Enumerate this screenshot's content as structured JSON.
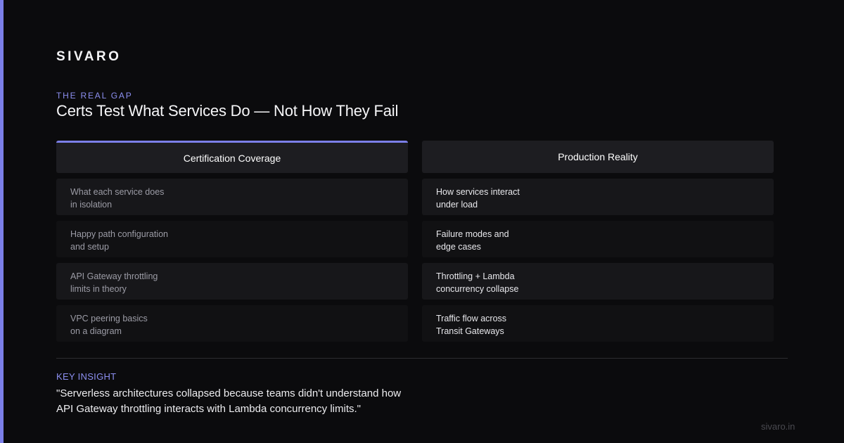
{
  "brand": "SIVARO",
  "eyebrow": "THE REAL GAP",
  "headline": "Certs Test What Services Do — Not How They Fail",
  "left_column": {
    "header": "Certification Coverage",
    "rows": [
      {
        "line1": "What each service does",
        "line2": "in isolation"
      },
      {
        "line1": "Happy path configuration",
        "line2": "and setup"
      },
      {
        "line1": "API Gateway throttling",
        "line2": "limits in theory"
      },
      {
        "line1": "VPC peering basics",
        "line2": "on a diagram"
      }
    ]
  },
  "right_column": {
    "header": "Production Reality",
    "rows": [
      {
        "line1": "How services interact",
        "line2": "under load"
      },
      {
        "line1": "Failure modes and",
        "line2": "edge cases"
      },
      {
        "line1": "Throttling + Lambda",
        "line2": "concurrency collapse"
      },
      {
        "line1": "Traffic flow across",
        "line2": "Transit Gateways"
      }
    ]
  },
  "insight": {
    "label": "KEY INSIGHT",
    "line1": "\"Serverless architectures collapsed because teams didn't understand how",
    "line2": "API Gateway throttling interacts with Lambda concurrency limits.\""
  },
  "site": "sivaro.in",
  "colors": {
    "accent": "#7b7fe8",
    "background": "#0b0b0d"
  }
}
